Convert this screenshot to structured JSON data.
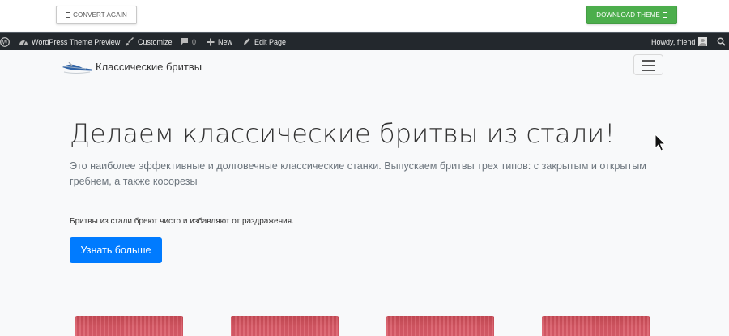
{
  "toolbar": {
    "convert_label": "CONVERT AGAIN",
    "download_label": "DOWNLOAD THEME",
    "download_color": "#4cae4c"
  },
  "admin_bar": {
    "logo_icon": "wordpress-icon",
    "site_label": "WordPress Theme Preview",
    "customize_label": "Customize",
    "comments_count": "0",
    "new_label": "New",
    "edit_label": "Edit Page",
    "greeting": "Howdy, friend",
    "background": "#23282d"
  },
  "header": {
    "brand_name": "Классические бритвы",
    "menu_icon": "hamburger-icon"
  },
  "hero": {
    "title": "Делаем классические бритвы из стали!",
    "lead": "Это наиболее эффективные и долговечные классические станки. Выпускаем бритвы трех типов: с закрытым и открытым гребнем, а также косорезы",
    "text": "Бритвы из стали бреют чисто и избавляют от раздражения.",
    "button_label": "Узнать больше",
    "button_color": "#007bff"
  },
  "cards": [
    {
      "image": "card-image-1"
    },
    {
      "image": "card-image-2"
    },
    {
      "image": "card-image-3"
    },
    {
      "image": "card-image-4"
    }
  ]
}
